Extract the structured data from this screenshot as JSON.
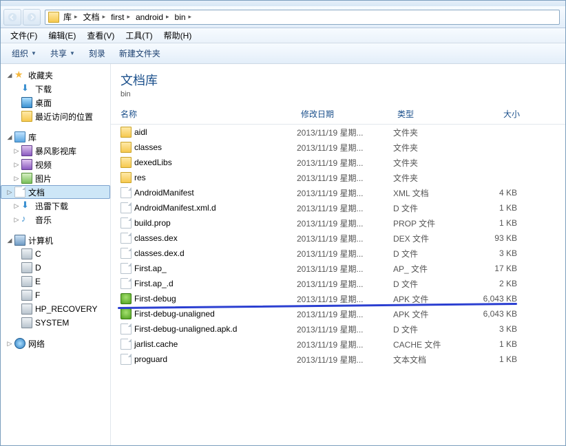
{
  "breadcrumbs": [
    "库",
    "文档",
    "first",
    "android",
    "bin"
  ],
  "menubar": [
    {
      "label": "文件(F)"
    },
    {
      "label": "编辑(E)"
    },
    {
      "label": "查看(V)"
    },
    {
      "label": "工具(T)"
    },
    {
      "label": "帮助(H)"
    }
  ],
  "toolbar": {
    "organize": "组织",
    "share": "共享",
    "burn": "刻录",
    "newfolder": "新建文件夹"
  },
  "sidebar": {
    "favorites": {
      "label": "收藏夹",
      "items": [
        {
          "label": "下载",
          "icon": "down"
        },
        {
          "label": "桌面",
          "icon": "blue"
        },
        {
          "label": "最近访问的位置",
          "icon": "folder"
        }
      ]
    },
    "libraries": {
      "label": "库",
      "items": [
        {
          "label": "暴风影视库",
          "icon": "video"
        },
        {
          "label": "视频",
          "icon": "video"
        },
        {
          "label": "图片",
          "icon": "pic"
        },
        {
          "label": "文档",
          "icon": "file",
          "selected": true
        },
        {
          "label": "迅雷下载",
          "icon": "down"
        },
        {
          "label": "音乐",
          "icon": "music"
        }
      ]
    },
    "computer": {
      "label": "计算机",
      "items": [
        {
          "label": "C",
          "icon": "disk"
        },
        {
          "label": "D",
          "icon": "disk"
        },
        {
          "label": "E",
          "icon": "disk"
        },
        {
          "label": "F",
          "icon": "disk"
        },
        {
          "label": "HP_RECOVERY",
          "icon": "disk"
        },
        {
          "label": "SYSTEM",
          "icon": "disk"
        }
      ]
    },
    "network": {
      "label": "网络"
    }
  },
  "library_header": {
    "title": "文档库",
    "subtitle": "bin"
  },
  "columns": {
    "name": "名称",
    "date": "修改日期",
    "type": "类型",
    "size": "大小"
  },
  "files": [
    {
      "name": "aidl",
      "date": "2013/11/19 星期...",
      "type": "文件夹",
      "size": "",
      "icon": "folder"
    },
    {
      "name": "classes",
      "date": "2013/11/19 星期...",
      "type": "文件夹",
      "size": "",
      "icon": "folder"
    },
    {
      "name": "dexedLibs",
      "date": "2013/11/19 星期...",
      "type": "文件夹",
      "size": "",
      "icon": "folder"
    },
    {
      "name": "res",
      "date": "2013/11/19 星期...",
      "type": "文件夹",
      "size": "",
      "icon": "folder"
    },
    {
      "name": "AndroidManifest",
      "date": "2013/11/19 星期...",
      "type": "XML 文档",
      "size": "4 KB",
      "icon": "file"
    },
    {
      "name": "AndroidManifest.xml.d",
      "date": "2013/11/19 星期...",
      "type": "D 文件",
      "size": "1 KB",
      "icon": "file"
    },
    {
      "name": "build.prop",
      "date": "2013/11/19 星期...",
      "type": "PROP 文件",
      "size": "1 KB",
      "icon": "file"
    },
    {
      "name": "classes.dex",
      "date": "2013/11/19 星期...",
      "type": "DEX 文件",
      "size": "93 KB",
      "icon": "file"
    },
    {
      "name": "classes.dex.d",
      "date": "2013/11/19 星期...",
      "type": "D 文件",
      "size": "3 KB",
      "icon": "file"
    },
    {
      "name": "First.ap_",
      "date": "2013/11/19 星期...",
      "type": "AP_ 文件",
      "size": "17 KB",
      "icon": "file"
    },
    {
      "name": "First.ap_.d",
      "date": "2013/11/19 星期...",
      "type": "D 文件",
      "size": "2 KB",
      "icon": "file"
    },
    {
      "name": "First-debug",
      "date": "2013/11/19 星期...",
      "type": "APK 文件",
      "size": "6,043 KB",
      "icon": "apk"
    },
    {
      "name": "First-debug-unaligned",
      "date": "2013/11/19 星期...",
      "type": "APK 文件",
      "size": "6,043 KB",
      "icon": "apk"
    },
    {
      "name": "First-debug-unaligned.apk.d",
      "date": "2013/11/19 星期...",
      "type": "D 文件",
      "size": "3 KB",
      "icon": "file"
    },
    {
      "name": "jarlist.cache",
      "date": "2013/11/19 星期...",
      "type": "CACHE 文件",
      "size": "1 KB",
      "icon": "file"
    },
    {
      "name": "proguard",
      "date": "2013/11/19 星期...",
      "type": "文本文档",
      "size": "1 KB",
      "icon": "file"
    }
  ]
}
